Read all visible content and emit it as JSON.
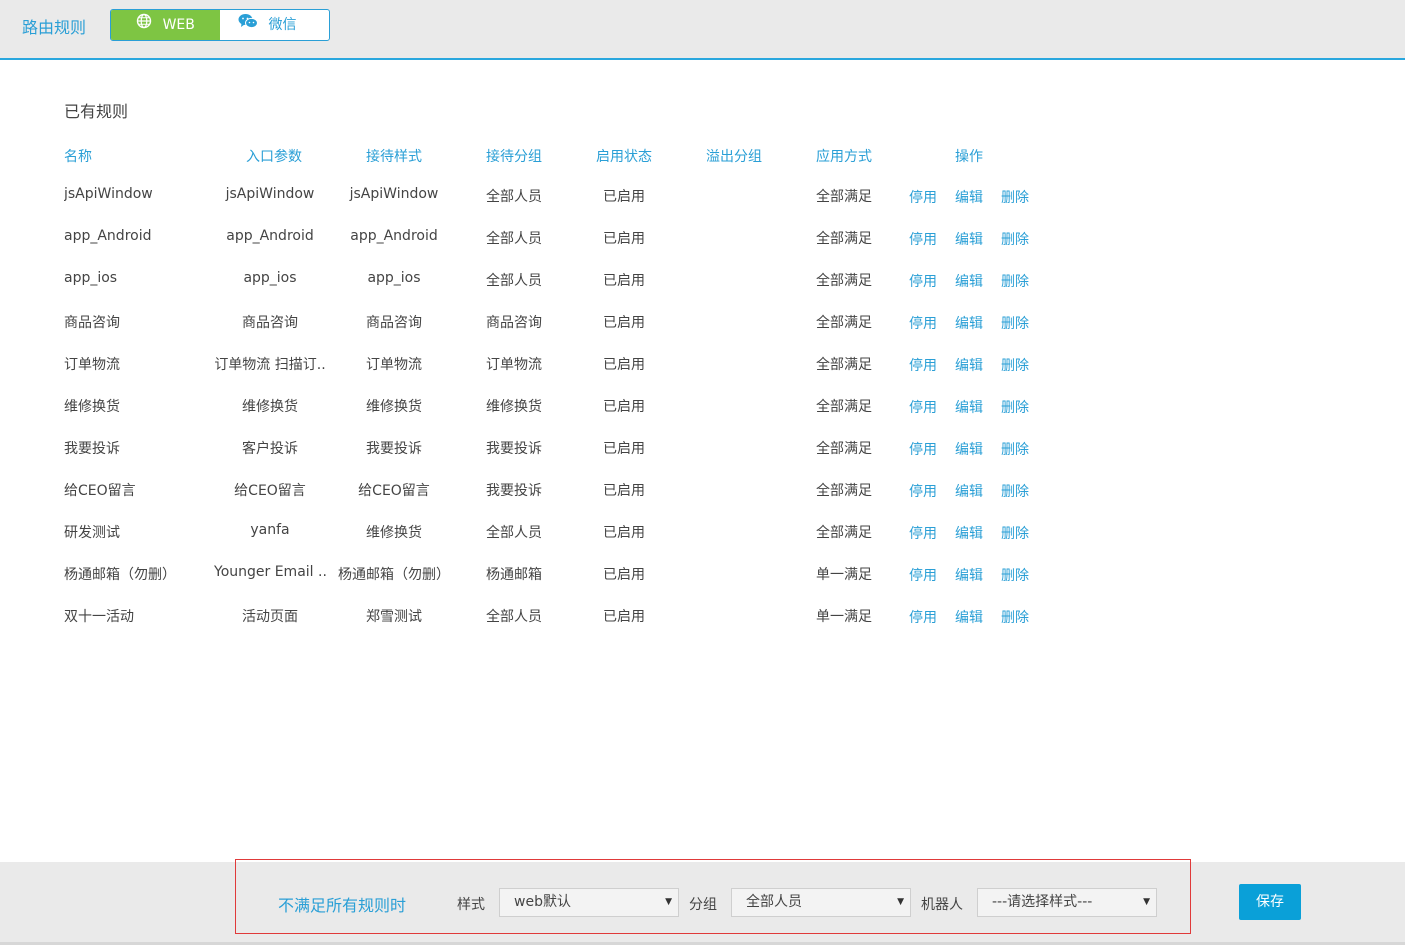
{
  "header": {
    "title": "路由规则",
    "tabs": [
      {
        "label": "WEB",
        "icon": "globe-icon",
        "active": true
      },
      {
        "label": "微信",
        "icon": "wechat-icon",
        "active": false
      }
    ]
  },
  "section_title": "已有规则",
  "table": {
    "columns": [
      "名称",
      "入口参数",
      "接待样式",
      "接待分组",
      "启用状态",
      "溢出分组",
      "应用方式",
      "操作"
    ],
    "actions": [
      "停用",
      "编辑",
      "删除"
    ],
    "rows": [
      {
        "name": "jsApiWindow",
        "entry": "jsApiWindow",
        "style": "jsApiWindow",
        "group": "全部人员",
        "status": "已启用",
        "overflow": "",
        "mode": "全部满足"
      },
      {
        "name": "app_Android",
        "entry": "app_Android",
        "style": "app_Android",
        "group": "全部人员",
        "status": "已启用",
        "overflow": "",
        "mode": "全部满足"
      },
      {
        "name": "app_ios",
        "entry": "app_ios",
        "style": "app_ios",
        "group": "全部人员",
        "status": "已启用",
        "overflow": "",
        "mode": "全部满足"
      },
      {
        "name": "商品咨询",
        "entry": "商品咨询",
        "style": "商品咨询",
        "group": "商品咨询",
        "status": "已启用",
        "overflow": "",
        "mode": "全部满足"
      },
      {
        "name": "订单物流",
        "entry": "订单物流 扫描订..",
        "style": "订单物流",
        "group": "订单物流",
        "status": "已启用",
        "overflow": "",
        "mode": "全部满足"
      },
      {
        "name": "维修换货",
        "entry": "维修换货",
        "style": "维修换货",
        "group": "维修换货",
        "status": "已启用",
        "overflow": "",
        "mode": "全部满足"
      },
      {
        "name": "我要投诉",
        "entry": "客户投诉",
        "style": "我要投诉",
        "group": "我要投诉",
        "status": "已启用",
        "overflow": "",
        "mode": "全部满足"
      },
      {
        "name": "给CEO留言",
        "entry": "给CEO留言",
        "style": "给CEO留言",
        "group": "我要投诉",
        "status": "已启用",
        "overflow": "",
        "mode": "全部满足"
      },
      {
        "name": "研发测试",
        "entry": "yanfa",
        "style": "维修换货",
        "group": "全部人员",
        "status": "已启用",
        "overflow": "",
        "mode": "全部满足"
      },
      {
        "name": "杨通邮箱（勿删）",
        "entry": "Younger Email ..",
        "style": "杨通邮箱（勿删）",
        "group": "杨通邮箱",
        "status": "已启用",
        "overflow": "",
        "mode": "单一满足"
      },
      {
        "name": "双十一活动",
        "entry": "活动页面",
        "style": "郑雪测试",
        "group": "全部人员",
        "status": "已启用",
        "overflow": "",
        "mode": "单一满足"
      }
    ]
  },
  "footer": {
    "label": "不满足所有规则时",
    "style_label": "样式",
    "style_value": "web默认",
    "group_label": "分组",
    "group_value": "全部人员",
    "robot_label": "机器人",
    "robot_value": "---请选择样式---",
    "save_label": "保存"
  },
  "colors": {
    "accent": "#2a9fd6",
    "web_tab": "#7ec543",
    "save_button": "#0aa0d8",
    "highlight_border": "#e03a3a"
  }
}
